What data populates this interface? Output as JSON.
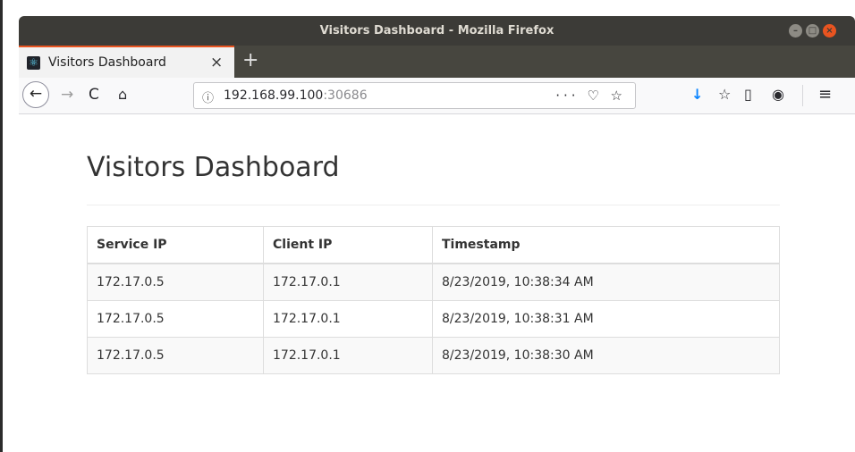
{
  "window": {
    "title": "Visitors Dashboard - Mozilla Firefox",
    "controls": {
      "minimize": "–",
      "maximize": "□",
      "close": "×"
    }
  },
  "tabs": [
    {
      "label": "Visitors Dashboard",
      "favicon": "react-icon",
      "close": "×"
    }
  ],
  "new_tab": "+",
  "toolbar": {
    "back": "←",
    "forward": "→",
    "reload": "C",
    "home": "⌂",
    "url_info": "ⓘ",
    "url_host": "192.168.99.100",
    "url_port": ":30686",
    "url_actions": "··· ♡ ☆",
    "download": "↓",
    "library": "☆",
    "sidebar": "▯",
    "account": "◉",
    "menu": "≡",
    "accent_color": "#0a84ff"
  },
  "page": {
    "title": "Visitors Dashboard",
    "table": {
      "headers": [
        "Service IP",
        "Client IP",
        "Timestamp"
      ],
      "rows": [
        [
          "172.17.0.5",
          "172.17.0.1",
          "8/23/2019, 10:38:34 AM"
        ],
        [
          "172.17.0.5",
          "172.17.0.1",
          "8/23/2019, 10:38:31 AM"
        ],
        [
          "172.17.0.5",
          "172.17.0.1",
          "8/23/2019, 10:38:30 AM"
        ]
      ]
    }
  },
  "colors": {
    "tab_accent": "#e95420",
    "titlebar": "#3c3b37",
    "close_button": "#e95420"
  }
}
